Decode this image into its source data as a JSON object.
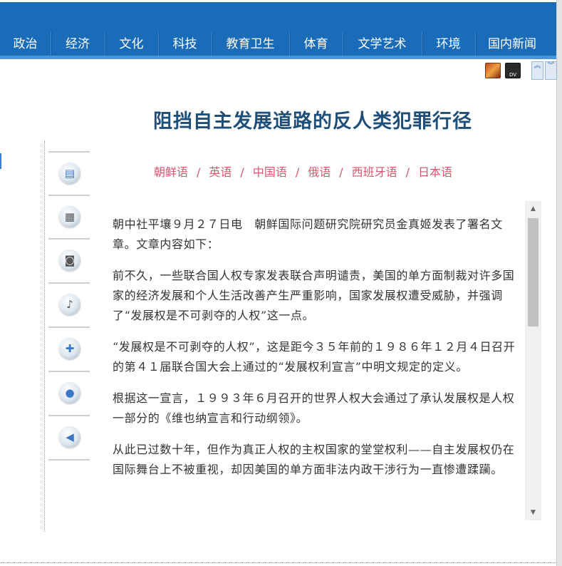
{
  "nav": {
    "items": [
      "政治",
      "经济",
      "文化",
      "科技",
      "教育卫生",
      "体育",
      "文学艺术",
      "环境",
      "国内新闻"
    ]
  },
  "toolbar": {
    "icons": [
      "photo-icon",
      "dv-video-icon",
      "scroll-up-icon",
      "scroll-down-icon"
    ],
    "dv_label": "DV"
  },
  "article": {
    "title": "阻挡自主发展道路的反人类犯罪行径",
    "languages": [
      "朝鲜语",
      "英语",
      "中国语",
      "俄语",
      "西班牙语",
      "日本语"
    ],
    "paragraphs": [
      "朝中社平壤９月２７日电　朝鲜国际问题研究院研究员金真姬发表了署名文章。文章内容如下：",
      "前不久，一些联合国人权专家发表联合声明谴责，美国的单方面制裁对许多国家的经济发展和个人生活改善产生严重影响，国家发展权遭受威胁，并强调了“发展权是不可剥夺的人权”这一点。",
      "“发展权是不可剥夺的人权”，这是距今３５年前的１９８６年１２月４日召开的第４１届联合国大会上通过的“发展权利宣言”中明文规定的定义。",
      "根据这一宣言，１９９３年６月召开的世界人权大会通过了承认发展权是人权一部分的《维也纳宣言和行动纲领》。",
      "从此已过数十年，但作为真正人权的主权国家的堂堂权利——自主发展权仍在国际舞台上不被重视，却因美国的单方面非法内政干涉行为一直惨遭蹂躏。"
    ]
  },
  "sidebar": {
    "icons": [
      "document-icon",
      "photo-gallery-icon",
      "camera-icon",
      "audio-icon",
      "user-add-icon",
      "user-icon",
      "back-icon"
    ]
  },
  "colors": {
    "nav_bg": "#1a6cb8",
    "title": "#1d4f7a",
    "lang_links": "#d8576f",
    "body_text": "#333333"
  }
}
